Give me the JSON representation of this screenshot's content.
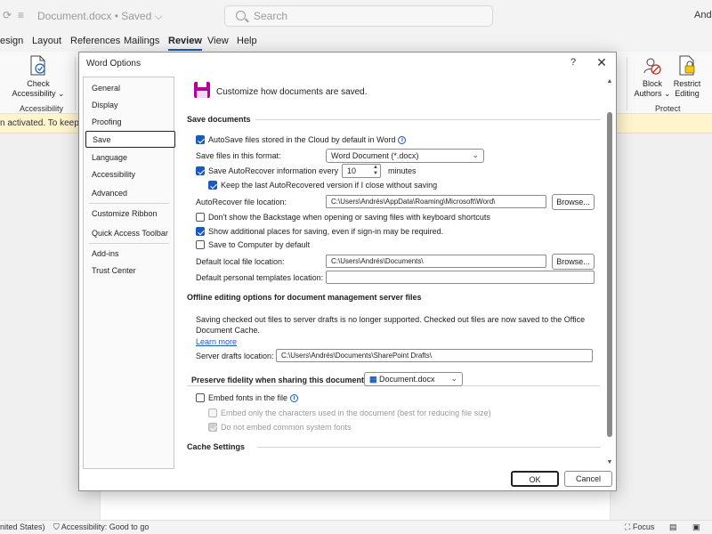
{
  "app": {
    "title": "Document.docx • Saved",
    "title_chevron": "⌵",
    "search_placeholder": "Search",
    "user": "And",
    "tabs": [
      "esign",
      "Layout",
      "References",
      "Mailings",
      "Review",
      "View",
      "Help"
    ],
    "active_tab": "Review"
  },
  "ribbon": {
    "check_accessibility_l1": "Check",
    "check_accessibility_l2": "Accessibility ⌄",
    "accessibility_group": "Accessibility",
    "block_authors_l1": "Block",
    "block_authors_l2": "Authors ⌄",
    "restrict_editing_l1": "Restrict",
    "restrict_editing_l2": "Editing",
    "protect_group": "Protect"
  },
  "infobar": {
    "text": "n activated. To keep usi"
  },
  "statusbar": {
    "language": "nited States)",
    "accessibility": "Accessibility: Good to go",
    "focus": "Focus"
  },
  "dialog": {
    "title": "Word Options",
    "help": "?",
    "close": "✕",
    "ok": "OK",
    "cancel": "Cancel",
    "nav": [
      "General",
      "Display",
      "Proofing",
      "Save",
      "Language",
      "Accessibility",
      "Advanced",
      "Customize Ribbon",
      "Quick Access Toolbar",
      "Add-ins",
      "Trust Center"
    ],
    "selected_nav": "Save",
    "header": "Customize how documents are saved.",
    "save_documents": {
      "heading": "Save documents",
      "autosave": "AutoSave files stored in the Cloud by default in Word",
      "format_label": "Save files in this format:",
      "format_value": "Word Document (*.docx)",
      "autorecover_label": "Save AutoRecover information every",
      "autorecover_minutes": "10",
      "minutes_label": "minutes",
      "keep_last": "Keep the last AutoRecovered version if I close without saving",
      "autorecover_location_label": "AutoRecover file location:",
      "autorecover_location_value": "C:\\Users\\Andrés\\AppData\\Roaming\\Microsoft\\Word\\",
      "browse": "Browse...",
      "dont_show_backstage": "Don't show the Backstage when opening or saving files with keyboard shortcuts",
      "show_additional": "Show additional places for saving, even if sign-in may be required.",
      "save_to_computer": "Save to Computer by default",
      "default_local_label": "Default local file location:",
      "default_local_value": "C:\\Users\\Andrés\\Documents\\",
      "default_templates_label": "Default personal templates location:",
      "default_templates_value": ""
    },
    "offline": {
      "heading": "Offline editing options for document management server files",
      "desc_l1": "Saving checked out files to server drafts is no longer supported. Checked out files are now saved to the Office",
      "desc_l2": "Document Cache.",
      "learn_more": "Learn more",
      "server_drafts_label": "Server drafts location:",
      "server_drafts_value": "C:\\Users\\Andrés\\Documents\\SharePoint Drafts\\"
    },
    "fidelity": {
      "heading": "Preserve fidelity when sharing this document:",
      "document": "Document.docx",
      "embed_fonts": "Embed fonts in the file",
      "embed_only_used": "Embed only the characters used in the document (best for reducing file size)",
      "no_common_fonts": "Do not embed common system fonts"
    },
    "cache": {
      "heading": "Cache Settings"
    }
  },
  "colors": {
    "accent": "#185abd",
    "save_icon": "#b4009e"
  }
}
